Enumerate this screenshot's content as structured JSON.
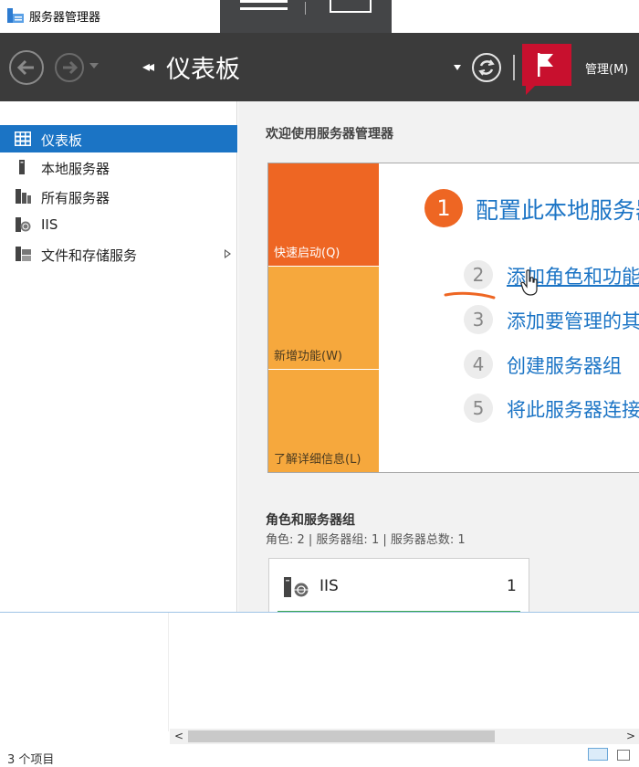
{
  "titlebar": {
    "title": "服务器管理器"
  },
  "header": {
    "title": "仪表板",
    "manage_label": "管理(M)"
  },
  "sidebar": {
    "items": [
      {
        "label": "仪表板",
        "active": true
      },
      {
        "label": "本地服务器"
      },
      {
        "label": "所有服务器"
      },
      {
        "label": "IIS"
      },
      {
        "label": "文件和存储服务"
      }
    ]
  },
  "main": {
    "welcome": "欢迎使用服务器管理器",
    "tiles": [
      {
        "label": "快速启动(Q)"
      },
      {
        "label": "新增功能(W)"
      },
      {
        "label": "了解详细信息(L)"
      }
    ],
    "steps": [
      {
        "num": "1",
        "text": "配置此本地服务器"
      },
      {
        "num": "2",
        "text": "添加角色和功能"
      },
      {
        "num": "3",
        "text": "添加要管理的其他服务器"
      },
      {
        "num": "4",
        "text": "创建服务器组"
      },
      {
        "num": "5",
        "text": "将此服务器连接到云服务"
      }
    ],
    "roles": {
      "title": "角色和服务器组",
      "summary": "角色: 2 | 服务器组: 1 | 服务器总数: 1",
      "cards": [
        {
          "name": "IIS",
          "count": "1"
        }
      ]
    }
  },
  "bottom": {
    "status": "3 个项目"
  },
  "colors": {
    "accent": "#1b74c5",
    "header_bg": "#3b3b3b",
    "tile_orange": "#ee6623",
    "tile_yellow": "#f6a83d",
    "flag_red": "#c8102e",
    "ok_green": "#3aa651"
  }
}
